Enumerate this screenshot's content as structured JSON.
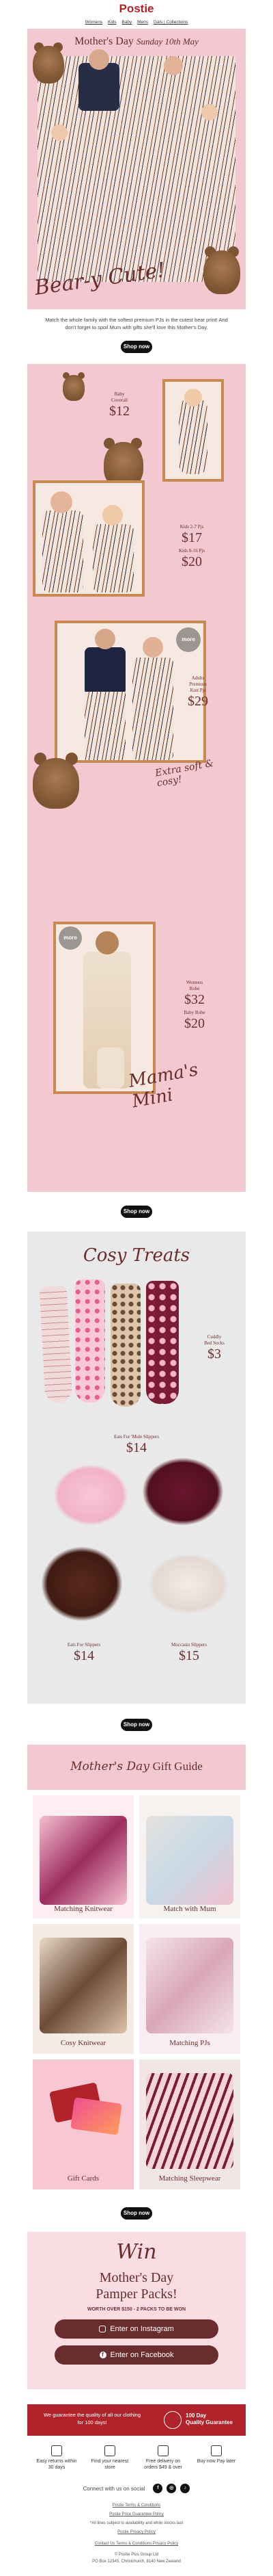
{
  "header": {
    "brand": "Postie",
    "nav": [
      "Womens",
      "Kids",
      "Baby",
      "Mens",
      "Gals | Collections"
    ]
  },
  "hero": {
    "title_main": "Mother's Day",
    "title_date": "Sunday 10th May",
    "script": "Bear-y Cute!",
    "body": "Match the whole family with the softest premium PJs in the cutest bear print! And don't forget to spoil Mum with gifts she'll love this Mother's Day.",
    "cta": "Shop now"
  },
  "family_section": {
    "baby_tag": {
      "line1": "Baby",
      "line2": "Coverall",
      "price": "$12"
    },
    "kids_tag": {
      "line1": "Kids 2-7 Pjs",
      "price1": "$17",
      "line2": "Kids 8-16 Pjs",
      "price2": "$20"
    },
    "adults_badge": "more",
    "adults_tag": {
      "line1": "Adults",
      "line2": "Premium",
      "line3": "Knit Pjs",
      "price": "$29"
    },
    "adults_script": "Extra soft & cosy!",
    "mama_badge": "more",
    "womens_tag": {
      "line1": "Womens",
      "line2": "Robe",
      "price1": "$32",
      "line3": "Baby Robe",
      "price2": "$20"
    },
    "mama_script": "Mama's Mini",
    "cta": "Shop now"
  },
  "cosy": {
    "title": "Cosy Treats",
    "socks_tag": {
      "line1": "Cuddly",
      "line2": "Bed Socks",
      "price": "$3"
    },
    "slippers_tag": {
      "line1": "Eats For 'Mule Slippers",
      "price": "$14"
    },
    "slide_tag": {
      "line1": "Eats For Slippers",
      "price": "$14"
    },
    "moccasin_tag": {
      "line1": "Moccasin Slippers",
      "price": "$15"
    },
    "cta": "Shop now"
  },
  "gift_guide": {
    "title_script": "Mother's Day",
    "title_rest": "Gift Guide",
    "items": [
      "Matching Knitwear",
      "Match with Mum",
      "Cosy Knitwear",
      "Matching PJs",
      "Gift Cards",
      "Matching Sleepwear"
    ],
    "cta": "Shop now"
  },
  "win": {
    "script": "Win",
    "title1": "Mother's Day",
    "title2": "Pamper Packs!",
    "sub": "WORTH OVER $150 - 2 PACKS TO BE WON",
    "btn_instagram": "Enter on Instagram",
    "btn_facebook": "Enter on Facebook"
  },
  "banner": {
    "left": "We guarantee the quality of all our clothing for 100 days!",
    "badge_line1": "100 Day",
    "badge_line2": "Quality Guarantee"
  },
  "usps": [
    {
      "icon": "box-icon",
      "text": "Easy returns within 30 days"
    },
    {
      "icon": "store-icon",
      "text": "Find your nearest store"
    },
    {
      "icon": "truck-icon",
      "text": "Free delivery on orders $49 & over"
    },
    {
      "icon": "card-icon",
      "text": "Buy now Pay later"
    }
  ],
  "connect": {
    "label": "Connect with us on social"
  },
  "footer": {
    "links": [
      "Postie Terms & Conditions",
      "Postie Price Guarantee Policy",
      "*All lines subject to availability and while stocks last",
      "Postie Privacy Policy",
      "Contact Us  Terms & Conditions  Privacy Policy"
    ],
    "address1": "© Postie Plus Group Ltd",
    "address2": "PO Box 12345, Christchurch, 8140 New Zealand"
  },
  "colors": {
    "pink_bg": "#f4c8d0",
    "light_pink": "#f9e1e5",
    "accent": "#6a2d2d",
    "banner_red": "#b0232a"
  }
}
